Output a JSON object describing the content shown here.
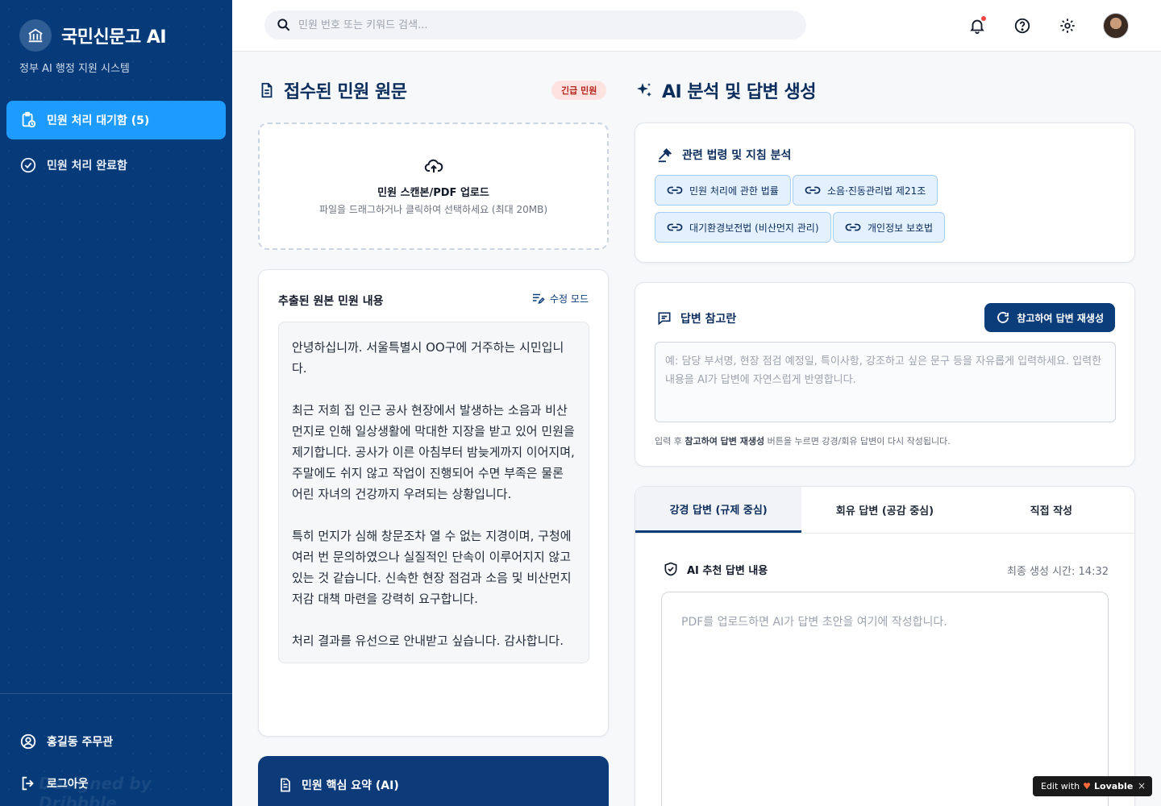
{
  "sidebar": {
    "brand": "국민신문고 AI",
    "subtitle": "정부 AI 행정 지원 시스템",
    "items": [
      {
        "label": "민원 처리 대기함 (5)",
        "icon": "clipboard-clock-icon",
        "active": true
      },
      {
        "label": "민원 처리 완료함",
        "icon": "check-circle-icon",
        "active": false
      }
    ],
    "user": "홍길동 주무관",
    "logout": "로그아웃",
    "watermark": "Designed by Dribbble"
  },
  "topbar": {
    "search_placeholder": "민원 번호 또는 키워드 검색..."
  },
  "left": {
    "title": "접수된 민원 원문",
    "badge": "긴급 민원",
    "upload_title": "민원 스캔본/PDF 업로드",
    "upload_desc": "파일을 드래그하거나 클릭하여 선택하세요 (최대 20MB)",
    "extract_title": "추출된 원본 민원 내용",
    "edit_mode": "수정 모드",
    "paragraphs": [
      "안녕하십니까. 서울특별시 OO구에 거주하는 시민입니다.",
      "최근 저희 집 인근 공사 현장에서 발생하는 소음과 비산먼지로 인해 일상생활에 막대한 지장을 받고 있어 민원을 제기합니다. 공사가 이른 아침부터 밤늦게까지 이어지며, 주말에도 쉬지 않고 작업이 진행되어 수면 부족은 물론 어린 자녀의 건강까지 우려되는 상황입니다.",
      "특히 먼지가 심해 창문조차 열 수 없는 지경이며, 구청에 여러 번 문의하였으나 실질적인 단속이 이루어지지 않고 있는 것 같습니다. 신속한 현장 점검과 소음 및 비산먼지 저감 대책 마련을 강력히 요구합니다.",
      "처리 결과를 유선으로 안내받고 싶습니다. 감사합니다."
    ],
    "summary_title": "민원 핵심 요약 (AI)"
  },
  "right": {
    "title": "AI 분석 및 답변 생성",
    "law_title": "관련 법령 및 지침 분석",
    "laws": [
      "민원 처리에 관한 법률",
      "소음·진동관리법 제21조",
      "대기환경보전법 (비산먼지 관리)",
      "개인정보 보호법"
    ],
    "ref_title": "답변 참고란",
    "regen_label": "참고하여 답변 재생성",
    "ref_placeholder": "예: 담당 부서명, 현장 점검 예정일, 특이사항, 강조하고 싶은 문구 등을 자유롭게 입력하세요. 입력한 내용을 AI가 답변에 자연스럽게 반영합니다.",
    "ref_note_prefix": "입력 후 ",
    "ref_note_bold": "참고하여 답변 재생성",
    "ref_note_suffix": " 버튼을 누르면 강경/회유 답변이 다시 작성됩니다.",
    "tabs": [
      "강경 답변 (규제 중심)",
      "회유 답변 (공감 중심)",
      "직접 작성"
    ],
    "ai_title": "AI 추천 답변 내용",
    "gen_time": "최종 생성 시간: 14:32",
    "ai_placeholder": "PDF를 업로드하면 AI가 답변 초안을 여기에 작성합니다."
  },
  "badge": {
    "edit_with": "Edit with",
    "brand": "Lovable",
    "close": "×"
  },
  "colors": {
    "sidebar": "#063a78",
    "accent": "#1e9bff",
    "primary": "#0b3d7a",
    "urgent_bg": "#fde2e1",
    "urgent_text": "#b42318"
  }
}
